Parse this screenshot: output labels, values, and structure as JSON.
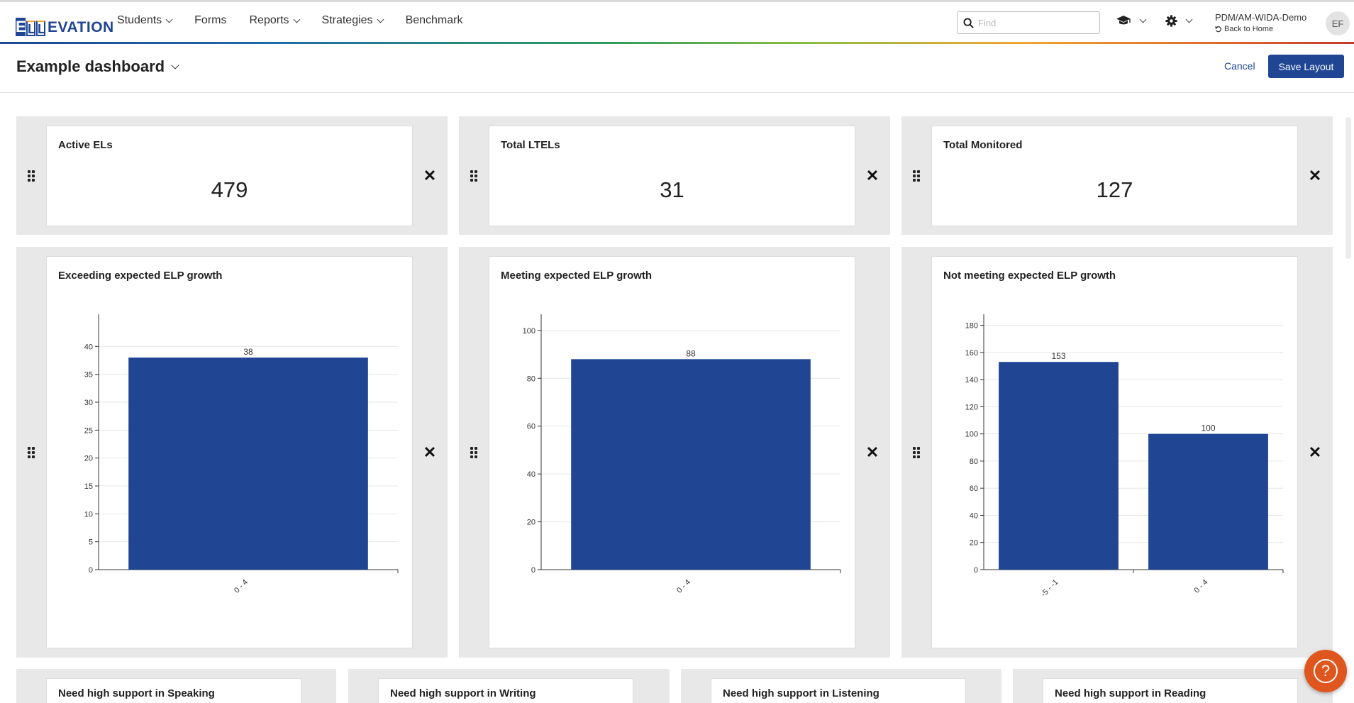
{
  "header": {
    "logo_e": "E",
    "logo_l1": "L",
    "logo_l2": "L",
    "logo_word": "EVATION",
    "nav": [
      {
        "label": "Students",
        "dropdown": true
      },
      {
        "label": "Forms",
        "dropdown": false
      },
      {
        "label": "Reports",
        "dropdown": true
      },
      {
        "label": "Strategies",
        "dropdown": true
      },
      {
        "label": "Benchmark",
        "dropdown": false
      }
    ],
    "search_placeholder": "Find",
    "district": "PDM/AM-WIDA-Demo",
    "back_home": "Back to Home",
    "avatar": "EF",
    "icons": [
      "graduation-cap-icon",
      "gear-icon",
      "search-icon",
      "undo-icon"
    ]
  },
  "page": {
    "title": "Example dashboard",
    "cancel_label": "Cancel",
    "save_label": "Save Layout"
  },
  "kpis": [
    {
      "title": "Active ELs",
      "value": "479"
    },
    {
      "title": "Total LTELs",
      "value": "31"
    },
    {
      "title": "Total Monitored",
      "value": "127"
    }
  ],
  "charts": [
    {
      "title": "Exceeding expected ELP growth"
    },
    {
      "title": "Meeting expected ELP growth"
    },
    {
      "title": "Not meeting expected ELP growth"
    }
  ],
  "chart_data": [
    {
      "type": "bar",
      "title": "Exceeding expected ELP growth",
      "categories": [
        "0 - 4"
      ],
      "values": [
        38
      ],
      "ylim": [
        0,
        45
      ],
      "yticks": [
        0,
        5,
        10,
        15,
        20,
        25,
        30,
        35,
        40
      ],
      "grid": true,
      "color": "#1f4593"
    },
    {
      "type": "bar",
      "title": "Meeting expected ELP growth",
      "categories": [
        "0 - 4"
      ],
      "values": [
        88
      ],
      "ylim": [
        0,
        105
      ],
      "yticks": [
        0,
        20,
        40,
        60,
        80,
        100
      ],
      "grid": true,
      "color": "#1f4593"
    },
    {
      "type": "bar",
      "title": "Not meeting expected ELP growth",
      "categories": [
        "-5 - -1",
        "0 - 4"
      ],
      "values": [
        153,
        100
      ],
      "ylim": [
        0,
        185
      ],
      "yticks": [
        0,
        20,
        40,
        60,
        80,
        100,
        120,
        140,
        160,
        180
      ],
      "grid": true,
      "color": "#1f4593"
    }
  ],
  "support_cards": [
    {
      "title": "Need high support in Speaking"
    },
    {
      "title": "Need high support in Writing"
    },
    {
      "title": "Need high support in Listening"
    },
    {
      "title": "Need high support in Reading"
    }
  ],
  "colors": {
    "brand": "#1f4593",
    "tile_bg": "#e8e8e8",
    "help": "#e0561f"
  }
}
